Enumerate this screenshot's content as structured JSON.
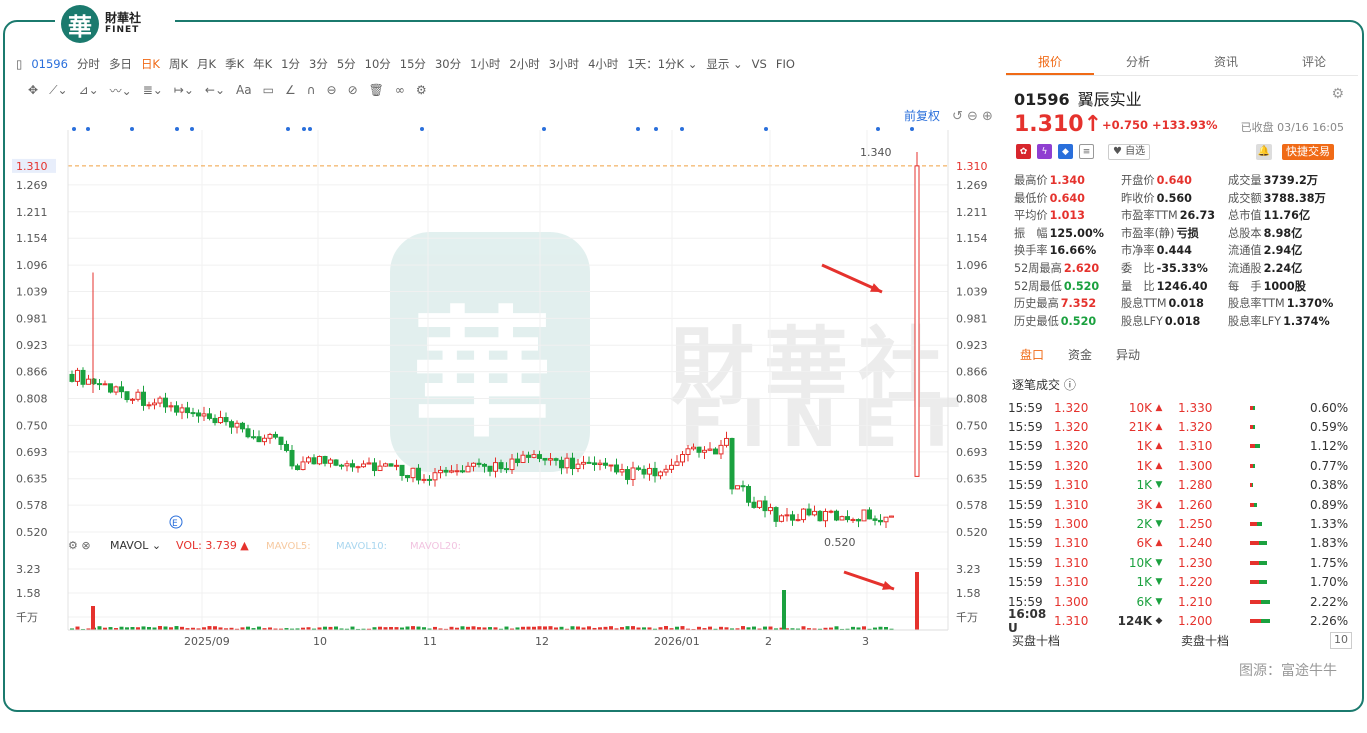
{
  "brand": {
    "logo_char": "華",
    "cn": "財華社",
    "en": "FINET"
  },
  "toolbar": {
    "code": "01596",
    "periods": [
      "分时",
      "多日",
      "日K",
      "周K",
      "月K",
      "季K",
      "年K",
      "1分",
      "3分",
      "5分",
      "10分",
      "15分",
      "30分",
      "1小时",
      "2小时",
      "3小时",
      "4小时"
    ],
    "active": "日K",
    "more": [
      "1天：1分K",
      "显示",
      "VS",
      "FIO"
    ]
  },
  "chart": {
    "fq": "前复权",
    "yticks": [
      "1.269",
      "1.211",
      "1.154",
      "1.096",
      "1.039",
      "0.981",
      "0.923",
      "0.866",
      "0.808",
      "0.750",
      "0.693",
      "0.635",
      "0.578",
      "0.520"
    ],
    "current_price": "1.310",
    "high_label": "1.340",
    "low_label": "0.520",
    "xticks": [
      "2025/09",
      "10",
      "11",
      "12",
      "2026/01",
      "2",
      "3"
    ],
    "vol_ticks": [
      "3.23",
      "1.58",
      "千万"
    ],
    "vol_legend": {
      "name": "MAVOL",
      "vol": "VOL:",
      "vol_val": "3.739",
      "ma5": "MAVOL5:",
      "ma10": "MAVOL10:",
      "ma20": "MAVOL20:"
    },
    "e_marker": "E"
  },
  "chart_data": {
    "type": "candlestick",
    "ylim": [
      0.52,
      1.34
    ],
    "last": 1.31,
    "high": 1.34,
    "low": 0.52,
    "volume_max_10m": 3.23
  },
  "panel": {
    "tabs": [
      "报价",
      "分析",
      "资讯",
      "评论"
    ],
    "code": "01596",
    "name": "翼辰实业",
    "price": "1.310",
    "arrow": "↑",
    "change": "+0.750",
    "pct": "+133.93%",
    "closed": "已收盘 03/16 16:05",
    "watch": "♥ 自选",
    "quick": "快捷交易",
    "stats": [
      [
        [
          "最高价",
          "1.340",
          "red"
        ],
        [
          "开盘价",
          "0.640",
          "red"
        ],
        [
          "成交量",
          "3739.2万",
          ""
        ]
      ],
      [
        [
          "最低价",
          "0.640",
          "red"
        ],
        [
          "昨收价",
          "0.560",
          ""
        ],
        [
          "成交额",
          "3788.38万",
          ""
        ]
      ],
      [
        [
          "平均价",
          "1.013",
          "red"
        ],
        [
          "市盈率TTM",
          "26.73",
          ""
        ],
        [
          "总市值",
          "11.76亿",
          ""
        ]
      ],
      [
        [
          "振　幅",
          "125.00%",
          ""
        ],
        [
          "市盈率(静)",
          "亏损",
          ""
        ],
        [
          "总股本",
          "8.98亿",
          ""
        ]
      ],
      [
        [
          "换手率",
          "16.66%",
          ""
        ],
        [
          "市净率",
          "0.444",
          ""
        ],
        [
          "流通值",
          "2.94亿",
          ""
        ]
      ],
      [
        [
          "52周最高",
          "2.620",
          "red"
        ],
        [
          "委　比",
          "-35.33%",
          ""
        ],
        [
          "流通股",
          "2.24亿",
          ""
        ]
      ],
      [
        [
          "52周最低",
          "0.520",
          "grn"
        ],
        [
          "量　比",
          "1246.40",
          ""
        ],
        [
          "每　手",
          "1000股",
          ""
        ]
      ],
      [
        [
          "历史最高",
          "7.352",
          "red"
        ],
        [
          "股息TTM",
          "0.018",
          ""
        ],
        [
          "股息率TTM",
          "1.370%",
          ""
        ]
      ],
      [
        [
          "历史最低",
          "0.520",
          "grn"
        ],
        [
          "股息LFY",
          "0.018",
          ""
        ],
        [
          "股息率LFY",
          "1.374%",
          ""
        ]
      ]
    ],
    "subtabs": [
      "盘口",
      "资金",
      "异动"
    ],
    "trades_title": "逐笔成交",
    "trades": [
      [
        "15:59",
        "1.320",
        "10K",
        "up"
      ],
      [
        "15:59",
        "1.320",
        "21K",
        "up"
      ],
      [
        "15:59",
        "1.320",
        "1K",
        "up"
      ],
      [
        "15:59",
        "1.320",
        "1K",
        "up"
      ],
      [
        "15:59",
        "1.310",
        "1K",
        "dn"
      ],
      [
        "15:59",
        "1.310",
        "3K",
        "up"
      ],
      [
        "15:59",
        "1.300",
        "2K",
        "dn"
      ],
      [
        "15:59",
        "1.310",
        "6K",
        "up"
      ],
      [
        "15:59",
        "1.310",
        "10K",
        "dn"
      ],
      [
        "15:59",
        "1.310",
        "1K",
        "dn"
      ],
      [
        "15:59",
        "1.300",
        "6K",
        "dn"
      ],
      [
        "16:08 U",
        "1.310",
        "124K",
        "nt"
      ]
    ],
    "levels": [
      [
        "1.330",
        "0.60%",
        0.08
      ],
      [
        "1.320",
        "0.59%",
        0.08
      ],
      [
        "1.310",
        "1.12%",
        0.16
      ],
      [
        "1.300",
        "0.77%",
        0.08
      ],
      [
        "1.280",
        "0.38%",
        0.05
      ],
      [
        "1.260",
        "0.89%",
        0.12
      ],
      [
        "1.250",
        "1.33%",
        0.2
      ],
      [
        "1.240",
        "1.83%",
        0.28
      ],
      [
        "1.230",
        "1.75%",
        0.28
      ],
      [
        "1.220",
        "1.70%",
        0.28
      ],
      [
        "1.210",
        "2.22%",
        0.34
      ],
      [
        "1.200",
        "2.26%",
        0.34
      ]
    ],
    "bid_title": "买盘十档",
    "ask_title": "卖盘十档",
    "ten": "10"
  },
  "source": "图源：富途牛牛"
}
